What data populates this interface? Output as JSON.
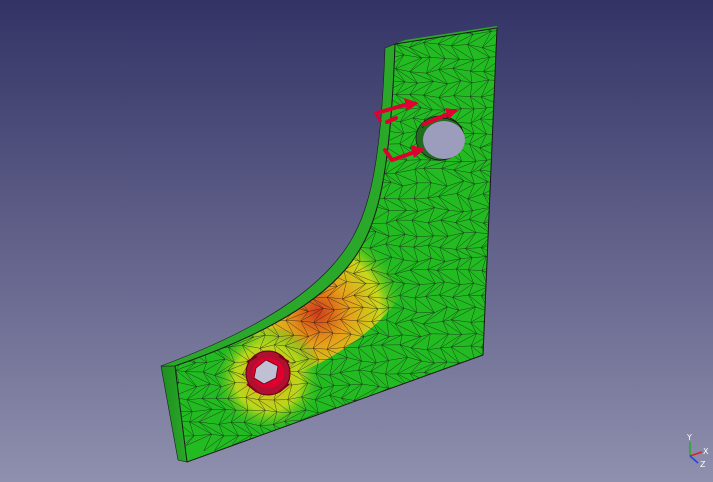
{
  "viewport": {
    "background_top": "#333366",
    "background_bottom": "#8f8fae"
  },
  "model": {
    "mesh_line_color": "#1a1a1a",
    "result_colors": {
      "low": "#22bb22",
      "mid": "#e6e01a",
      "high": "#d23a1a"
    },
    "fixed_constraint_color": "#e00030",
    "force_arrow_color": "#e00030",
    "hole_interior_color": "#b8b8cc"
  },
  "axis_triad": {
    "y_label": "Y",
    "x_label": "X",
    "z_label": "Z",
    "x_color": "#dd2222",
    "y_color": "#22aa22",
    "z_color": "#2244dd"
  }
}
